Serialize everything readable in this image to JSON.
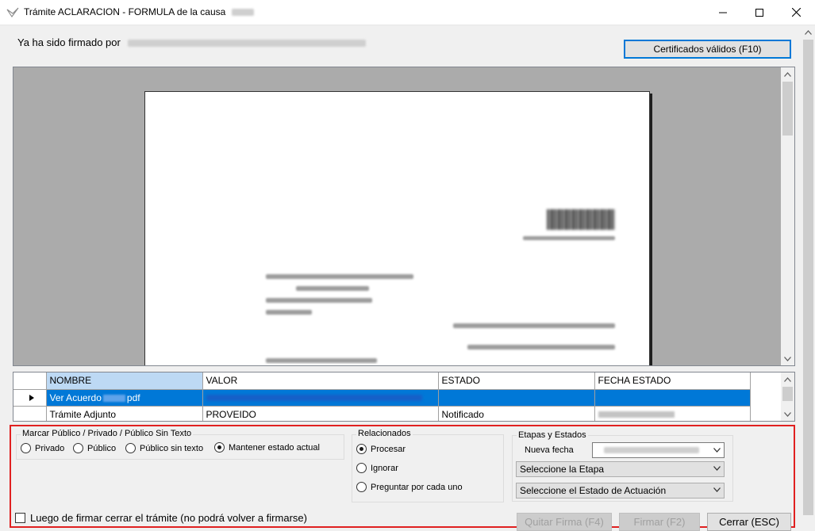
{
  "window": {
    "title": "Trámite ACLARACION - FORMULA de la causa",
    "minimize_glyph": "—",
    "maximize_glyph": "☐",
    "close_glyph": "✕"
  },
  "header": {
    "signed_by_label": "Ya ha sido firmado por",
    "certificates_button": "Certificados válidos (F10)"
  },
  "grid": {
    "columns": [
      "NOMBRE",
      "VALOR",
      "ESTADO",
      "FECHA ESTADO"
    ],
    "rows": [
      {
        "nombre_prefix": "Ver Acuerdo",
        "nombre_suffix": "pdf",
        "valor": "",
        "estado": "",
        "selected": true
      },
      {
        "nombre": "Trámite Adjunto",
        "valor": "PROVEIDO",
        "estado": "Notificado",
        "selected": false
      }
    ]
  },
  "visibility": {
    "legend": "Marcar Público / Privado / Público Sin Texto",
    "options": [
      "Privado",
      "Público",
      "Público sin texto",
      "Mantener estado actual"
    ],
    "selected": "Mantener estado actual"
  },
  "related": {
    "legend": "Relacionados",
    "options": [
      "Procesar",
      "Ignorar",
      "Preguntar por cada uno"
    ],
    "selected": "Procesar"
  },
  "stages": {
    "legend": "Etapas y Estados",
    "new_date_label": "Nueva fecha",
    "stage_select": "Seleccione la Etapa",
    "state_select": "Seleccione el Estado de Actuación"
  },
  "footer": {
    "close_after_sign": "Luego de firmar cerrar el trámite (no podrá volver a firmarse)",
    "remove_sign_button": "Quitar Firma (F4)",
    "sign_button": "Firmar (F2)",
    "close_button": "Cerrar (ESC)"
  },
  "colors": {
    "selection": "#0078d7",
    "header_sorted": "#bdd9f4",
    "outline": "#e02020",
    "focus_border": "#0078d7"
  }
}
